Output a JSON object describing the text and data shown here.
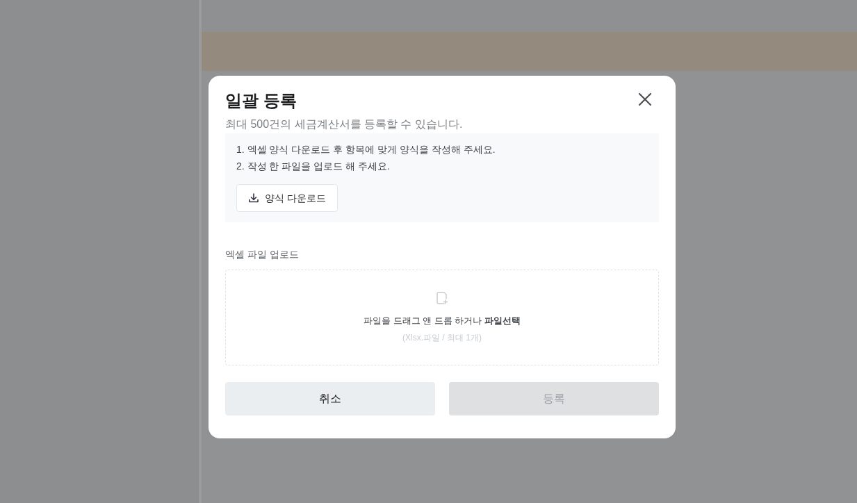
{
  "dialog": {
    "title": "일괄 등록",
    "subtitle": "최대 500건의 세금계산서를 등록할 수 있습니다.",
    "instructions": [
      "1. 엑셀 양식 다운로드 후 항목에 맞게 양식을 작성해 주세요.",
      "2. 작성 한 파일을 업로드 해 주세요."
    ],
    "download_button": "양식 다운로드",
    "upload": {
      "label": "엑셀 파일 업로드",
      "prompt": "파일을 드래그 앤 드롭 하거나 **파일선택**",
      "hint": "(Xlsx.파일 / 최대 1개)"
    },
    "buttons": [
      {
        "label": "취소",
        "kind": "cancel",
        "disabled": false
      },
      {
        "label": "등록",
        "kind": "submit",
        "disabled": true
      }
    ]
  }
}
